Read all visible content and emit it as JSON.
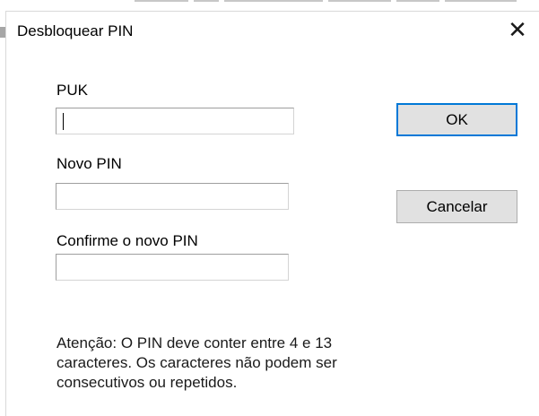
{
  "window": {
    "title": "Desbloquear PIN",
    "close_icon": "close-icon",
    "close_glyph": "✕"
  },
  "form": {
    "puk_label": "PUK",
    "puk_value": "",
    "new_pin_label": "Novo PIN",
    "new_pin_value": "",
    "confirm_pin_label": "Confirme o novo PIN",
    "confirm_pin_value": ""
  },
  "buttons": {
    "ok_label": "OK",
    "cancel_label": "Cancelar"
  },
  "note": {
    "line1": "Atenção: O PIN deve conter entre 4 e 13",
    "line2": "caracteres. Os caracteres não podem ser",
    "line3": "consecutivos ou repetidos."
  },
  "colors": {
    "default_button_border": "#0078d7",
    "button_face": "#e1e1e1"
  }
}
